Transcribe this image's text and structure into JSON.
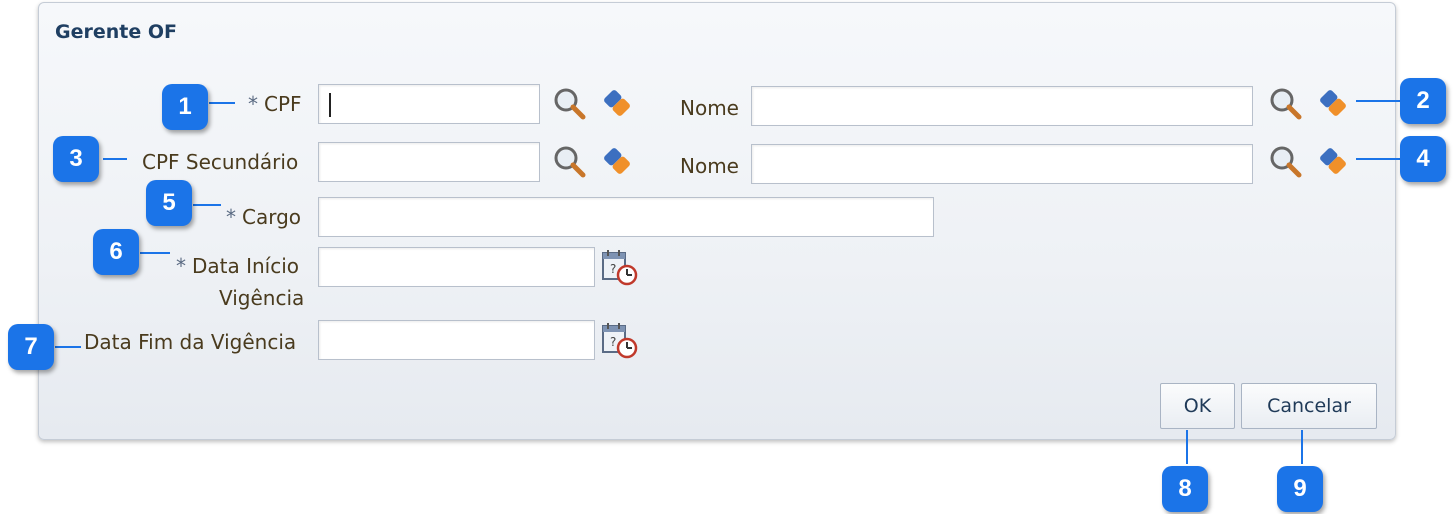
{
  "dialog": {
    "title": "Gerente OF",
    "fields": {
      "cpf": {
        "required_mark": "*",
        "label": "CPF",
        "value": ""
      },
      "nome1": {
        "label": "Nome",
        "value": ""
      },
      "cpf_secundario": {
        "label": "CPF Secundário",
        "value": ""
      },
      "nome2": {
        "label": "Nome",
        "value": ""
      },
      "cargo": {
        "required_mark": "*",
        "label": "Cargo",
        "value": ""
      },
      "data_inicio": {
        "required_mark": "*",
        "label_line1": "Data Início",
        "label_line2": "Vigência",
        "value": ""
      },
      "data_fim": {
        "label": "Data Fim da Vigência",
        "value": ""
      }
    },
    "buttons": {
      "ok": "OK",
      "cancel": "Cancelar"
    }
  },
  "callouts": [
    "1",
    "2",
    "3",
    "4",
    "5",
    "6",
    "7",
    "8",
    "9"
  ],
  "colors": {
    "callout": "#1b74e8",
    "title": "#1f3f62",
    "label": "#4a3b1e"
  }
}
